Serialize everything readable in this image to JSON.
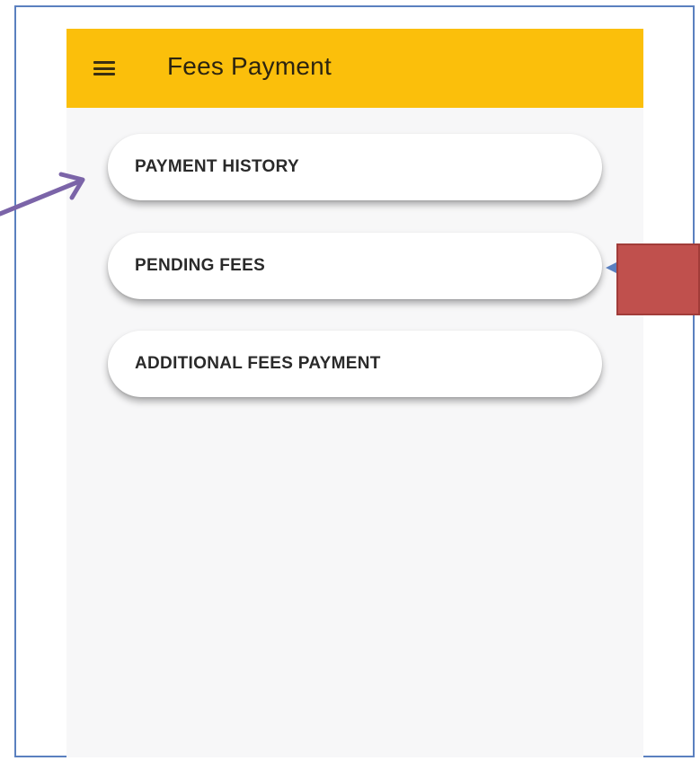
{
  "app": {
    "title": "Fees Payment"
  },
  "icons": {
    "menu": "hamburger-menu-icon"
  },
  "menu": {
    "items": [
      {
        "label": "PAYMENT HISTORY"
      },
      {
        "label": "PENDING FEES"
      },
      {
        "label": "ADDITIONAL FEES PAYMENT"
      }
    ]
  },
  "colors": {
    "appbar": "#fbbf0b",
    "background": "#f7f7f8",
    "annotation_arrow": "#7b64a8",
    "annotation_box": "#c0504d",
    "frame_border": "#5b80bf"
  }
}
